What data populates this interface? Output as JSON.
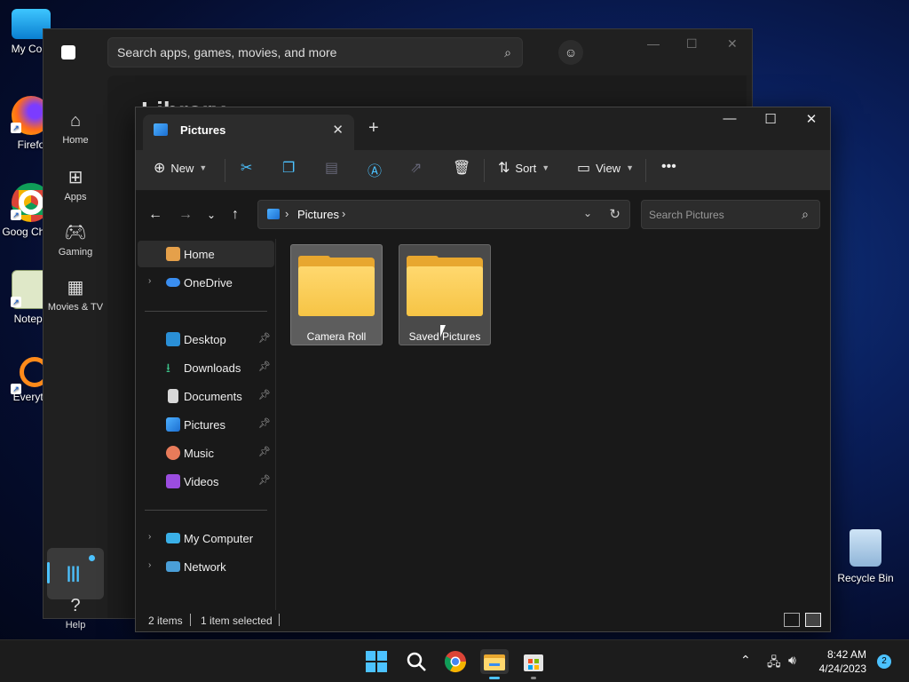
{
  "desktop": {
    "icons": [
      {
        "label": "My Com",
        "name": "my-computer"
      },
      {
        "label": "Firefo",
        "name": "firefox"
      },
      {
        "label": "Goog Chron",
        "name": "google-chrome"
      },
      {
        "label": "Notepa",
        "name": "notepad"
      },
      {
        "label": "Everyth",
        "name": "everything"
      }
    ],
    "recycle_bin": "Recycle Bin"
  },
  "store": {
    "search_placeholder": "Search apps, games, movies, and more",
    "nav": [
      {
        "label": "Home",
        "icon": "home-icon"
      },
      {
        "label": "Apps",
        "icon": "apps-icon"
      },
      {
        "label": "Gaming",
        "icon": "gaming-icon"
      },
      {
        "label": "Movies & TV",
        "icon": "movies-icon"
      },
      {
        "label": "Help",
        "icon": "help-icon"
      }
    ],
    "heading": "Library"
  },
  "explorer": {
    "tab_title": "Pictures",
    "toolbar": {
      "new_label": "New",
      "sort_label": "Sort",
      "view_label": "View"
    },
    "address": {
      "crumb": "Pictures",
      "search_placeholder": "Search Pictures"
    },
    "sidebar": [
      {
        "label": "Home"
      },
      {
        "label": "OneDrive"
      },
      {
        "label": "Desktop"
      },
      {
        "label": "Downloads"
      },
      {
        "label": "Documents"
      },
      {
        "label": "Pictures"
      },
      {
        "label": "Music"
      },
      {
        "label": "Videos"
      },
      {
        "label": "My Computer"
      },
      {
        "label": "Network"
      }
    ],
    "folders": [
      {
        "name": "Camera Roll"
      },
      {
        "name": "Saved Pictures"
      }
    ],
    "status": {
      "items": "2 items",
      "selected": "1 item selected"
    }
  },
  "taskbar": {
    "time": "8:42 AM",
    "date": "4/24/2023",
    "notifications": "2"
  }
}
